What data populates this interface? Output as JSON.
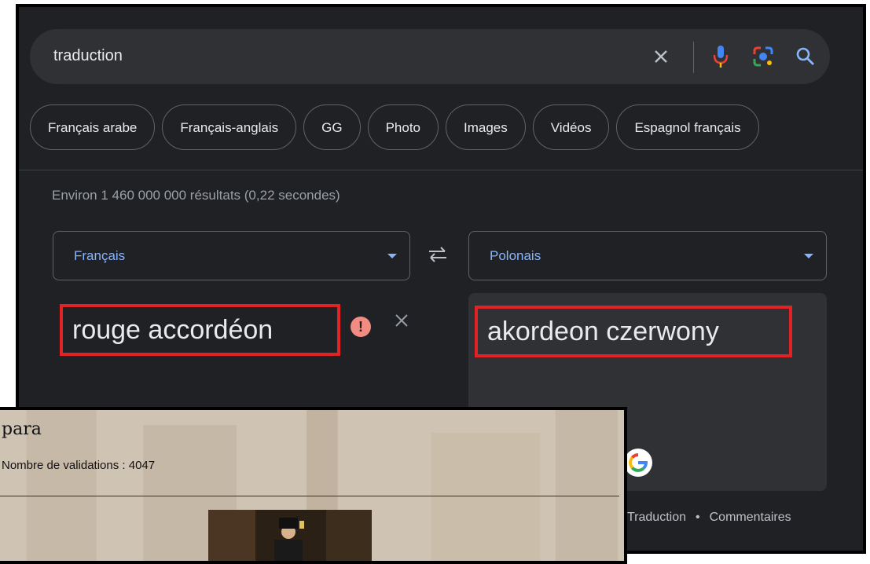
{
  "search": {
    "query": "traduction"
  },
  "chips": [
    "Français arabe",
    "Français-anglais",
    "GG",
    "Photo",
    "Images",
    "Vidéos",
    "Espagnol français"
  ],
  "result_count": "Environ 1 460 000 000 résultats (0,22 secondes)",
  "translator": {
    "source_language": "Français",
    "target_language": "Polonais",
    "source_text": "rouge accordéon",
    "target_text": "akordeon czerwony"
  },
  "footer": {
    "links": [
      "Traduction",
      "Commentaires"
    ],
    "separator": "•"
  },
  "overlay": {
    "title": "para",
    "meta": "Nombre de validations : 4047"
  },
  "colors": {
    "background": "#202124",
    "surface": "#303134",
    "accent_blue": "#8ab4f8",
    "highlight_box": "#e32226",
    "error": "#f28b82"
  },
  "icons": [
    "clear-icon",
    "mic-icon",
    "lens-icon",
    "search-icon",
    "swap-icon",
    "error-icon",
    "google-logo-icon"
  ]
}
